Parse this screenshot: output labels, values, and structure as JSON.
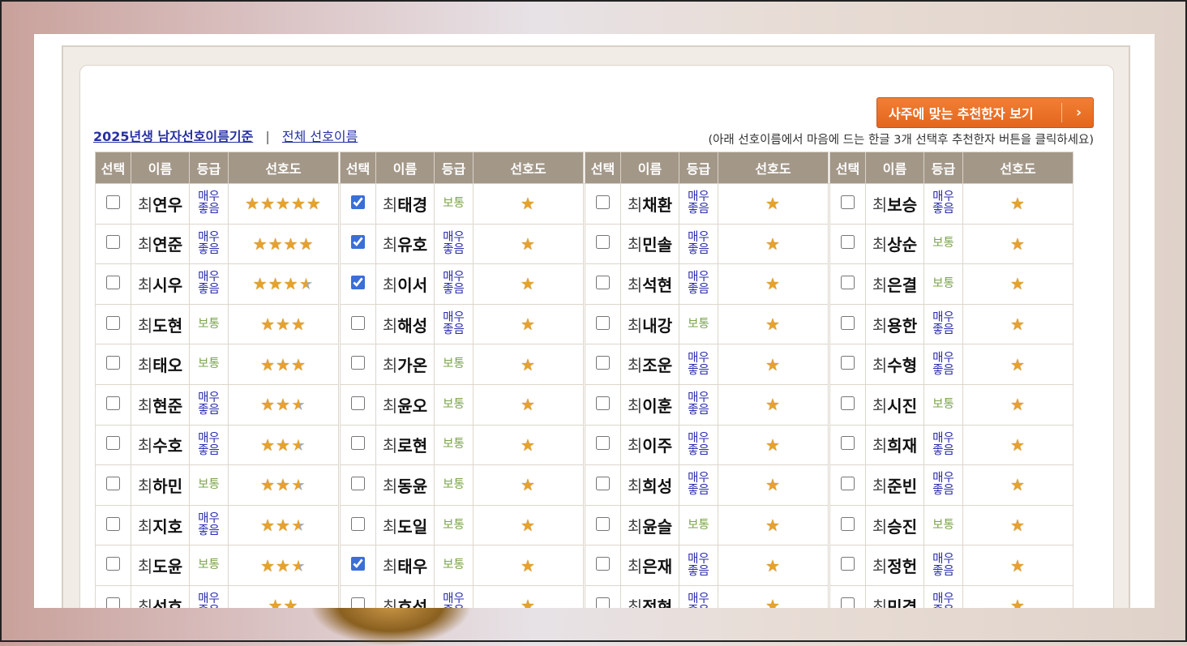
{
  "header": {
    "saju_button": "사주에 맞는 추천한자 보기",
    "chevron_icon": "chevron-right-icon",
    "tab_active": "2025년생 남자선호이름기준",
    "tab_separator": "|",
    "tab_other": "전체 선호이름",
    "hint": "(아래 선호이름에서 마음에 드는 한글 3개 선택후 추천한자 버튼을 클릭하세요)"
  },
  "table": {
    "headers": [
      "선택",
      "이름",
      "등급",
      "선호도"
    ],
    "surname": "최",
    "columns": [
      [
        {
          "given": "연우",
          "grade": "매우좋음",
          "stars": 5,
          "checked": false
        },
        {
          "given": "연준",
          "grade": "매우좋음",
          "stars": 4,
          "checked": false
        },
        {
          "given": "시우",
          "grade": "매우좋음",
          "stars": 3.5,
          "checked": false
        },
        {
          "given": "도현",
          "grade": "보통",
          "stars": 3,
          "checked": false
        },
        {
          "given": "태오",
          "grade": "보통",
          "stars": 3,
          "checked": false
        },
        {
          "given": "현준",
          "grade": "매우좋음",
          "stars": 2.5,
          "checked": false
        },
        {
          "given": "수호",
          "grade": "매우좋음",
          "stars": 2.5,
          "checked": false
        },
        {
          "given": "하민",
          "grade": "보통",
          "stars": 2.5,
          "checked": false
        },
        {
          "given": "지호",
          "grade": "매우좋음",
          "stars": 2.5,
          "checked": false
        },
        {
          "given": "도윤",
          "grade": "보통",
          "stars": 2.5,
          "checked": false
        },
        {
          "given": "선호",
          "grade": "매우좋음",
          "stars": 2,
          "checked": false
        }
      ],
      [
        {
          "given": "태경",
          "grade": "보통",
          "stars": 1,
          "checked": true
        },
        {
          "given": "유호",
          "grade": "매우좋음",
          "stars": 1,
          "checked": true
        },
        {
          "given": "이서",
          "grade": "매우좋음",
          "stars": 1,
          "checked": true
        },
        {
          "given": "해성",
          "grade": "매우좋음",
          "stars": 1,
          "checked": false
        },
        {
          "given": "가온",
          "grade": "보통",
          "stars": 1,
          "checked": false
        },
        {
          "given": "윤오",
          "grade": "보통",
          "stars": 1,
          "checked": false
        },
        {
          "given": "로현",
          "grade": "보통",
          "stars": 1,
          "checked": false
        },
        {
          "given": "동윤",
          "grade": "보통",
          "stars": 1,
          "checked": false
        },
        {
          "given": "도일",
          "grade": "보통",
          "stars": 1,
          "checked": false
        },
        {
          "given": "태우",
          "grade": "보통",
          "stars": 1,
          "checked": true
        },
        {
          "given": "호성",
          "grade": "매우좋음",
          "stars": 1,
          "checked": false
        }
      ],
      [
        {
          "given": "채환",
          "grade": "매우좋음",
          "stars": 1,
          "checked": false
        },
        {
          "given": "민솔",
          "grade": "매우좋음",
          "stars": 1,
          "checked": false
        },
        {
          "given": "석현",
          "grade": "매우좋음",
          "stars": 1,
          "checked": false
        },
        {
          "given": "내강",
          "grade": "보통",
          "stars": 1,
          "checked": false
        },
        {
          "given": "조운",
          "grade": "매우좋음",
          "stars": 1,
          "checked": false
        },
        {
          "given": "이훈",
          "grade": "매우좋음",
          "stars": 1,
          "checked": false
        },
        {
          "given": "이주",
          "grade": "매우좋음",
          "stars": 1,
          "checked": false
        },
        {
          "given": "희성",
          "grade": "매우좋음",
          "stars": 1,
          "checked": false
        },
        {
          "given": "윤슬",
          "grade": "보통",
          "stars": 1,
          "checked": false
        },
        {
          "given": "은재",
          "grade": "매우좋음",
          "stars": 1,
          "checked": false
        },
        {
          "given": "정현",
          "grade": "매우좋음",
          "stars": 1,
          "checked": false
        }
      ],
      [
        {
          "given": "보승",
          "grade": "매우좋음",
          "stars": 1,
          "checked": false
        },
        {
          "given": "상순",
          "grade": "보통",
          "stars": 1,
          "checked": false
        },
        {
          "given": "은결",
          "grade": "보통",
          "stars": 1,
          "checked": false
        },
        {
          "given": "용한",
          "grade": "매우좋음",
          "stars": 1,
          "checked": false
        },
        {
          "given": "수형",
          "grade": "매우좋음",
          "stars": 1,
          "checked": false
        },
        {
          "given": "시진",
          "grade": "보통",
          "stars": 1,
          "checked": false
        },
        {
          "given": "희재",
          "grade": "매우좋음",
          "stars": 1,
          "checked": false
        },
        {
          "given": "준빈",
          "grade": "매우좋음",
          "stars": 1,
          "checked": false
        },
        {
          "given": "승진",
          "grade": "보통",
          "stars": 1,
          "checked": false
        },
        {
          "given": "정헌",
          "grade": "매우좋음",
          "stars": 1,
          "checked": false
        },
        {
          "given": "민겸",
          "grade": "매우좋음",
          "stars": 1,
          "checked": false
        }
      ]
    ]
  },
  "colors": {
    "good_grade": "#2a2cad",
    "normal_grade": "#7aa34a",
    "header_bg": "#a39788",
    "button": "#e8701f",
    "star": "#e7a12c"
  }
}
